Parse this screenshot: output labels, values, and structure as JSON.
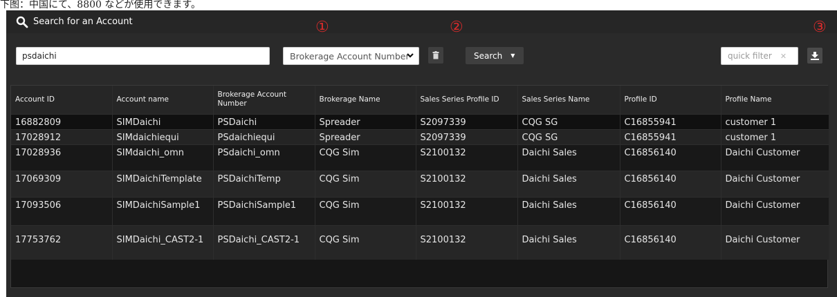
{
  "caption": "下图：中国にて、8800 などが使用できます。",
  "header": {
    "title": "Search for an Account",
    "icon": "search-icon"
  },
  "markers": [
    "①",
    "②",
    "③"
  ],
  "search": {
    "value": "psdaichi",
    "button_label": "Search"
  },
  "select": {
    "selected": "Brokerage Account Number"
  },
  "quick_filter": {
    "placeholder": "quick filter",
    "clear": "✕"
  },
  "table": {
    "columns": [
      "Account ID",
      "Account name",
      "Brokerage Account Number",
      "Brokerage Name",
      "Sales Series Profile ID",
      "Sales Series Name",
      "Profile ID",
      "Profile Name"
    ],
    "rows": [
      [
        "16882809",
        "SIMDaichi",
        "PSDaichi",
        "Spreader",
        "S2097339",
        "CQG SG",
        "C16855941",
        "customer 1"
      ],
      [
        "17028912",
        "SIMdaichiequi",
        "PSdaichiequi",
        "Spreader",
        "S2097339",
        "CQG SG",
        "C16855941",
        "customer 1"
      ],
      [
        "17028936",
        "SIMdaichi_omn",
        "PSdaichi_omn",
        "CQG Sim",
        "S2100132",
        "Daichi Sales",
        "C16856140",
        "Daichi Customer"
      ],
      [
        "17069309",
        "SIMDaichiTemplate",
        "PSDaichiTemp",
        "CQG Sim",
        "S2100132",
        "Daichi Sales",
        "C16856140",
        "Daichi Customer"
      ],
      [
        "17093506",
        "SIMDaichiSample1",
        "PSDaichiSample1",
        "CQG Sim",
        "S2100132",
        "Daichi Sales",
        "C16856140",
        "Daichi Customer"
      ],
      [
        "17753762",
        "SIMDaichi_CAST2-1",
        "PSDaichi_CAST2-1",
        "CQG Sim",
        "S2100132",
        "Daichi Sales",
        "C16856140",
        "Daichi Customer"
      ]
    ]
  },
  "colors": {
    "panel": "#2a2a2a",
    "marker": "#d92b2b"
  }
}
